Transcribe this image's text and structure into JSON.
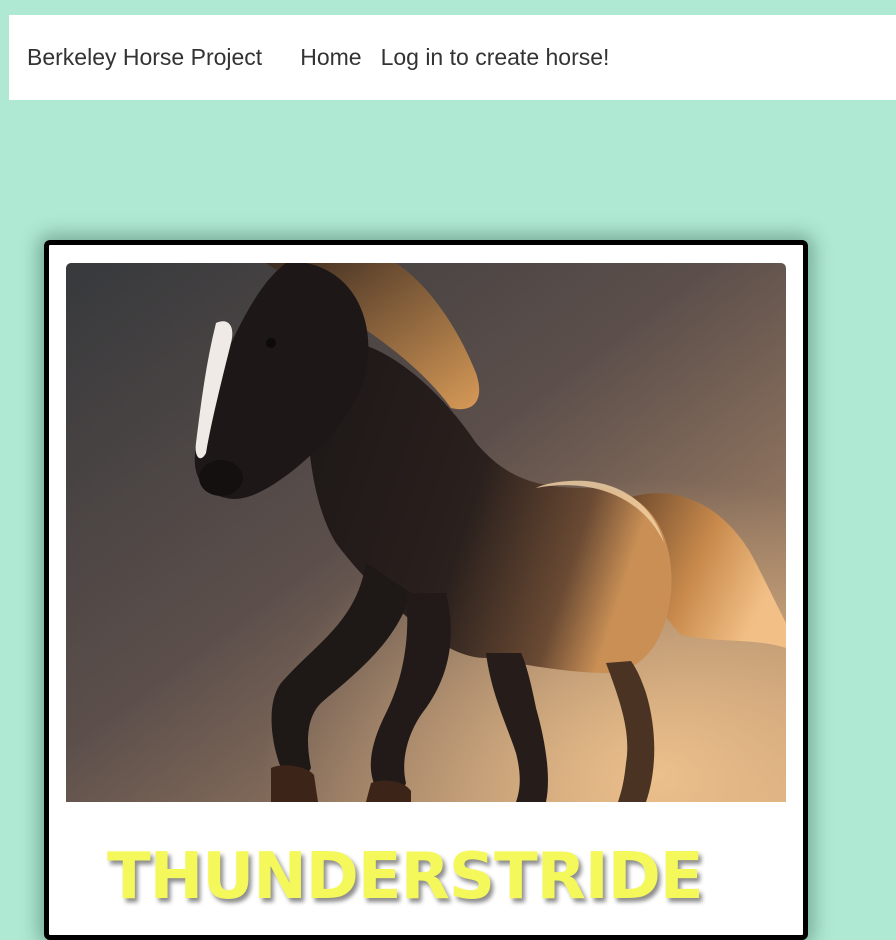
{
  "navbar": {
    "brand": "Berkeley Horse Project",
    "links": [
      {
        "label": "Home"
      },
      {
        "label": "Log in to create horse!"
      }
    ]
  },
  "horse_card": {
    "image_alt": "horse",
    "name": "THUNDERSTRIDE"
  },
  "colors": {
    "page_background": "#afe9d4",
    "horse_name": "#f5f85a"
  }
}
